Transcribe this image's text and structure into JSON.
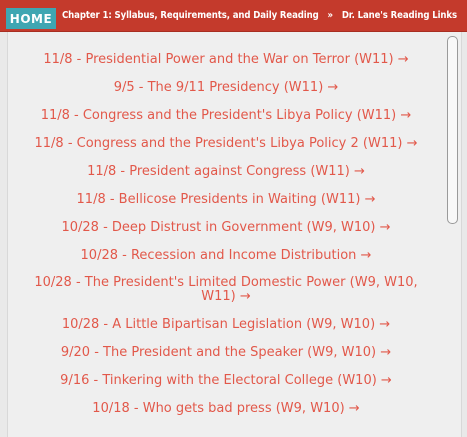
{
  "breadcrumb": {
    "home": "HOME",
    "items": [
      "Chapter 1: Syllabus, Requirements, and Daily Reading",
      "Dr. Lane's Reading Links"
    ],
    "separator": "»"
  },
  "links": [
    "11/8 - Presidential Power and the War on Terror (W11) →",
    "9/5 - The 9/11 Presidency (W11) →",
    "11/8 - Congress and the President's Libya Policy (W11) →",
    "11/8 - Congress and the President's Libya Policy 2 (W11) →",
    "11/8 - President against Congress (W11) →",
    "11/8 - Bellicose Presidents in Waiting (W11) →",
    "10/28 - Deep Distrust in Government (W9, W10) →",
    "10/28 - Recession and Income Distribution →",
    "10/28 - The President's Limited Domestic Power (W9, W10, W11) →",
    "10/28 - A Little Bipartisan Legislation (W9, W10) →",
    "9/20 - The President and the Speaker (W9, W10) →",
    "9/16 - Tinkering with the Electoral College (W10) →",
    "10/18 - Who gets bad press (W9, W10) →"
  ],
  "colors": {
    "topbar": "#c43a2c",
    "home_button": "#3fa6b2",
    "link": "#e2584a",
    "panel": "#efefef"
  }
}
